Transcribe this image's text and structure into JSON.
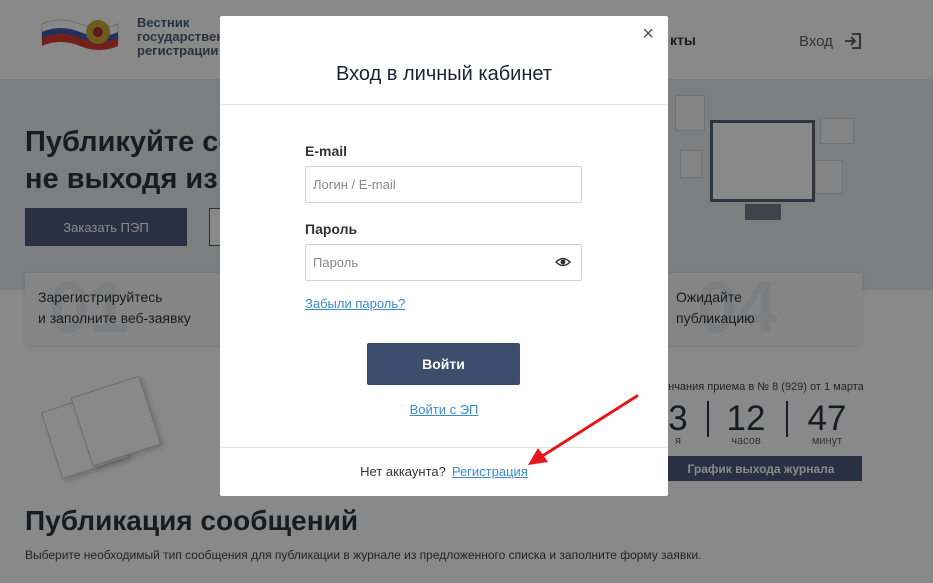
{
  "header": {
    "logo_lines": [
      "Вестник",
      "государствен",
      "регистрации"
    ],
    "nav_item": "кты",
    "login_label": "Вход"
  },
  "hero": {
    "title_line1": "Публикуйте со",
    "title_line2": "не выходя из д",
    "order_button": "Заказать ПЭП"
  },
  "steps": [
    {
      "num": "01",
      "line1": "Зарегистрируйтесь",
      "line2": "и заполните веб-заявку"
    },
    {
      "num": "04",
      "line1": "Ожидайте",
      "line2": "публикацию"
    }
  ],
  "countdown": {
    "label": "ончания приема в № 8 (929) от 1 марта",
    "items": [
      {
        "value": "3",
        "unit": "я"
      },
      {
        "value": "12",
        "unit": "часов"
      },
      {
        "value": "47",
        "unit": "минут"
      }
    ],
    "schedule_button": "График выхода журнала"
  },
  "publication": {
    "title": "Публикация сообщений",
    "description": "Выберите необходимый тип сообщения для публикации в журнале из предложенного списка и заполните форму заявки."
  },
  "modal": {
    "close_glyph": "×",
    "title": "Вход в личный кабинет",
    "email_label": "E-mail",
    "email_placeholder": "Логин / E-mail",
    "password_label": "Пароль",
    "password_placeholder": "Пароль",
    "forgot_link": "Забыли пароль?",
    "submit_button": "Войти",
    "ep_link": "Войти с ЭП",
    "no_account_text": "Нет аккаунта?",
    "register_link": "Регистрация"
  },
  "icons": {
    "eye": "eye-icon",
    "logout": "login-door-icon",
    "close": "close-icon"
  },
  "colors": {
    "primary": "#3d4d6e",
    "link": "#3a8bc8",
    "annotation_arrow": "#e3171c"
  }
}
